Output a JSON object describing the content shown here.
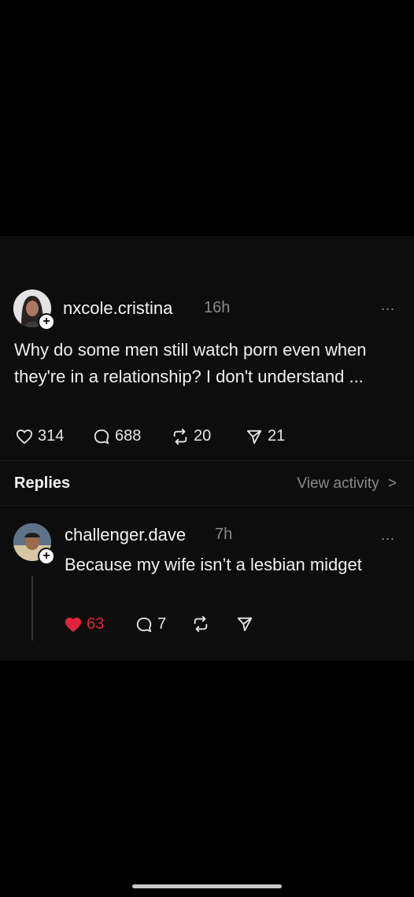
{
  "post": {
    "username": "nxcole.cristina",
    "time": "16h",
    "more": "...",
    "text": "Why do some men still watch porn even when they're in a relationship? I don't understand ...",
    "likes": "314",
    "comments": "688",
    "reposts": "20",
    "shares": "21"
  },
  "replies_section": {
    "label": "Replies",
    "view_activity": "View activity",
    "chevron": ">"
  },
  "reply": {
    "username": "challenger.dave",
    "time": "7h",
    "more": "...",
    "text": "Because my wife isn’t a lesbian midget",
    "likes": "63",
    "comments": "7"
  },
  "icons": {
    "like": "heart-icon",
    "comment": "comment-bubble-icon",
    "repost": "repost-icon",
    "share": "share-icon",
    "follow": "plus-icon"
  },
  "colors": {
    "background": "#000000",
    "card": "#0d0d0d",
    "muted_text": "#8a8a8a",
    "liked_red": "#e0243c"
  }
}
